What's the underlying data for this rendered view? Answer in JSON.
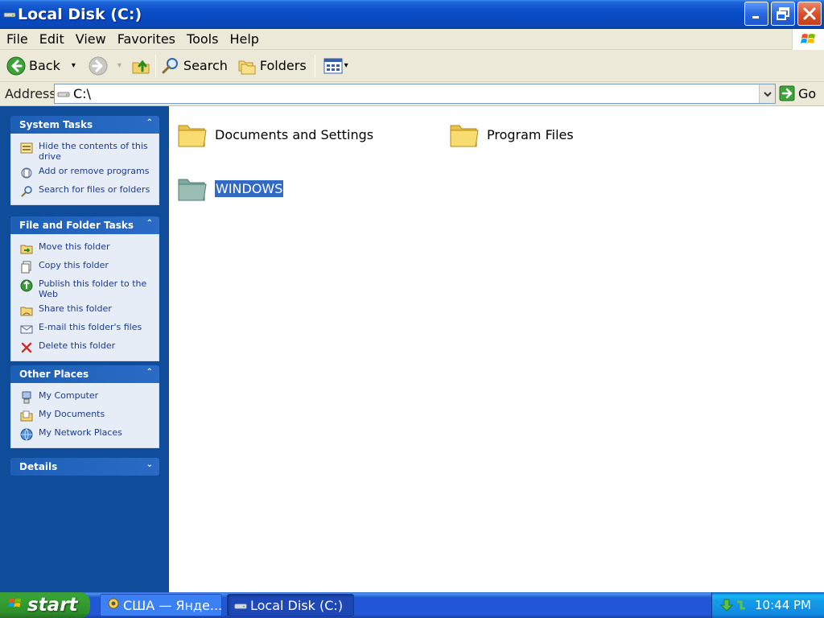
{
  "window": {
    "title": "Local Disk (C:)"
  },
  "menu": [
    "File",
    "Edit",
    "View",
    "Favorites",
    "Tools",
    "Help"
  ],
  "toolbar": {
    "back": "Back",
    "search": "Search",
    "folders": "Folders"
  },
  "address": {
    "label": "Address",
    "value": "C:\\",
    "go": "Go"
  },
  "taskpane": {
    "system_tasks": {
      "title": "System Tasks",
      "items": [
        "Hide the contents of this drive",
        "Add or remove programs",
        "Search for files or folders"
      ]
    },
    "file_folder_tasks": {
      "title": "File and Folder Tasks",
      "items": [
        "Move this folder",
        "Copy this folder",
        "Publish this folder to the Web",
        "Share this folder",
        "E-mail this folder's files",
        "Delete this folder"
      ]
    },
    "other_places": {
      "title": "Other Places",
      "items": [
        "My Computer",
        "My Documents",
        "My Network Places"
      ]
    },
    "details": {
      "title": "Details"
    }
  },
  "folders": [
    {
      "name": "Documents and Settings",
      "selected": false
    },
    {
      "name": "Program Files",
      "selected": false
    },
    {
      "name": "WINDOWS",
      "selected": true
    }
  ],
  "taskbar": {
    "start": "start",
    "tasks": [
      {
        "label": "США — Янде...",
        "active": false
      },
      {
        "label": "Local Disk (C:)",
        "active": true
      }
    ],
    "clock": "10:44 PM"
  },
  "colors": {
    "title_blue": "#0a4ec8",
    "taskpane_blue": "#0f4c9a",
    "selection": "#316ac5",
    "start_green": "#37a334"
  }
}
